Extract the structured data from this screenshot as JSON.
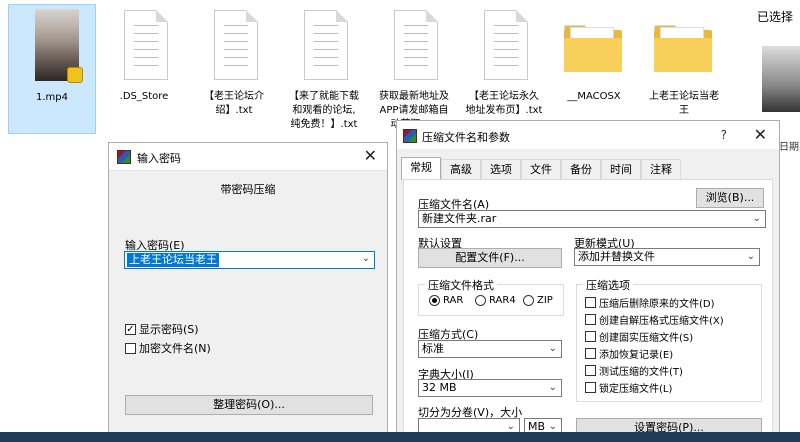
{
  "explorer": {
    "files": [
      {
        "name": "1.mp4",
        "kind": "video",
        "selected": true
      },
      {
        "name": ".DS_Store",
        "kind": "doc"
      },
      {
        "name": "【老王论坛介\n绍】.txt",
        "kind": "doc"
      },
      {
        "name": "【来了就能下载\n和观看的论坛,\n纯免费！】.txt",
        "kind": "doc"
      },
      {
        "name": "获取最新地址及\nAPP请发邮箱自\n动获取.txt",
        "kind": "doc"
      },
      {
        "name": "【老王论坛永久\n地址发布页】.txt",
        "kind": "doc"
      },
      {
        "name": "__MACOSX",
        "kind": "folder"
      },
      {
        "name": "上老王论坛当老\n王",
        "kind": "folder"
      }
    ],
    "side_label": "已选择",
    "side_label2": "日期"
  },
  "password_dialog": {
    "title": "输入密码",
    "close_glyph": "✕",
    "heading": "带密码压缩",
    "input_label": "输入密码(E)",
    "input_value": "上老王论坛当老王",
    "dropdown_glyph": "⌄",
    "show_password": {
      "label": "显示密码(S)",
      "checked": true,
      "glyph": "✓"
    },
    "encrypt_names": {
      "label": "加密文件名(N)",
      "checked": false
    },
    "organize_button": "整理密码(O)..."
  },
  "archive_dialog": {
    "title": "压缩文件名和参数",
    "help_glyph": "?",
    "close_glyph": "✕",
    "tabs": [
      "常规",
      "高级",
      "选项",
      "文件",
      "备份",
      "时间",
      "注释"
    ],
    "active_tab": 0,
    "archive_name_label": "压缩文件名(A)",
    "browse_button": "浏览(B)...",
    "archive_name_value": "新建文件夹.rar",
    "default_settings_label": "默认设置",
    "profiles_button": "配置文件(F)...",
    "update_mode_label": "更新模式(U)",
    "update_mode_value": "添加并替换文件",
    "format_group": "压缩文件格式",
    "formats": [
      {
        "label": "RAR",
        "checked": true
      },
      {
        "label": "RAR4",
        "checked": false
      },
      {
        "label": "ZIP",
        "checked": false
      }
    ],
    "method_label": "压缩方式(C)",
    "method_value": "标准",
    "dict_label": "字典大小(I)",
    "dict_value": "32 MB",
    "split_label": "切分为分卷(V)，大小",
    "split_unit": "MB",
    "options_group": "压缩选项",
    "options": [
      "压缩后删除原来的文件(D)",
      "创建自解压格式压缩文件(X)",
      "创建固实压缩文件(S)",
      "添加恢复记录(E)",
      "测试压缩的文件(T)",
      "锁定压缩文件(L)"
    ],
    "set_password_button": "设置密码(P)..."
  }
}
